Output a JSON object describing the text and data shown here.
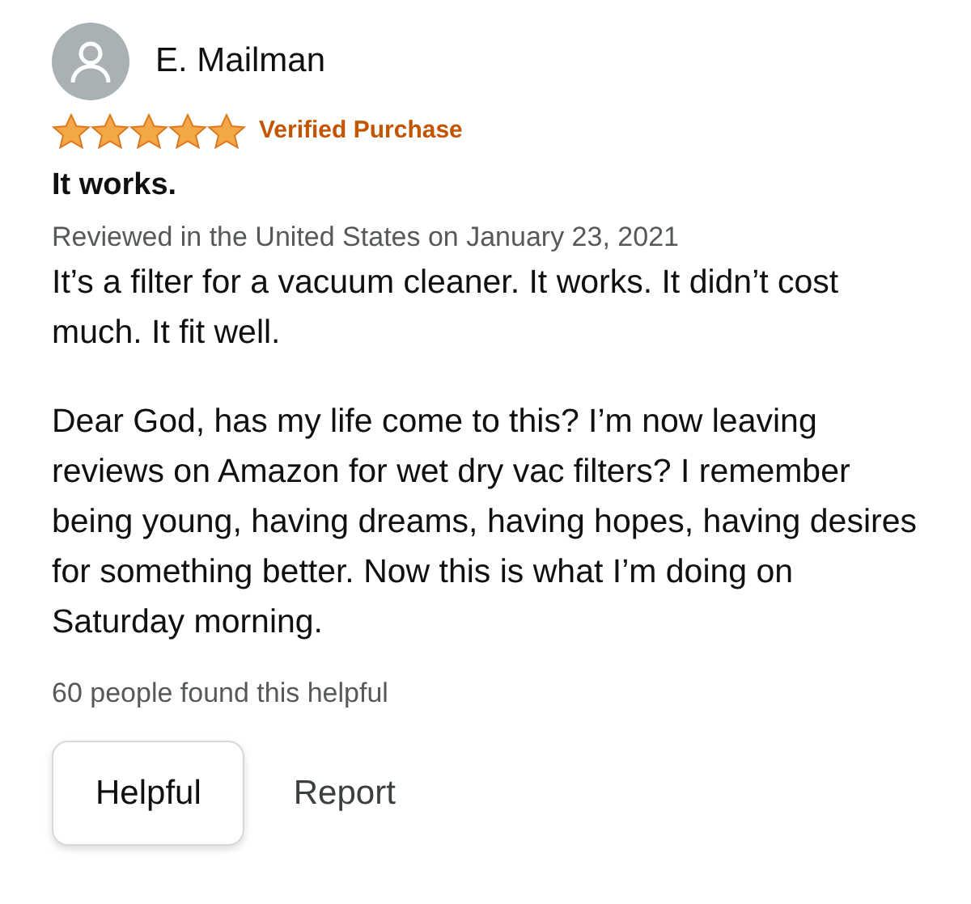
{
  "reviewer": {
    "name": "E. Mailman"
  },
  "stars": 5,
  "badge": "Verified Purchase",
  "title": "It works.",
  "date": "Reviewed in the United States on January 23, 2021",
  "paragraphs": [
    "It’s a filter for a vacuum cleaner. It works. It didn’t cost much. It fit well.",
    "Dear God, has my life come to this? I’m now leaving reviews on Amazon for wet dry vac filters? I remember being young, having dreams, having hopes, having desires for something better. Now this is what I’m doing on Saturday morning."
  ],
  "helpful_count": "60 people found this helpful",
  "buttons": [
    {
      "label": "Helpful",
      "kind": "outlined"
    },
    {
      "label": "Report",
      "kind": "plain"
    }
  ]
}
